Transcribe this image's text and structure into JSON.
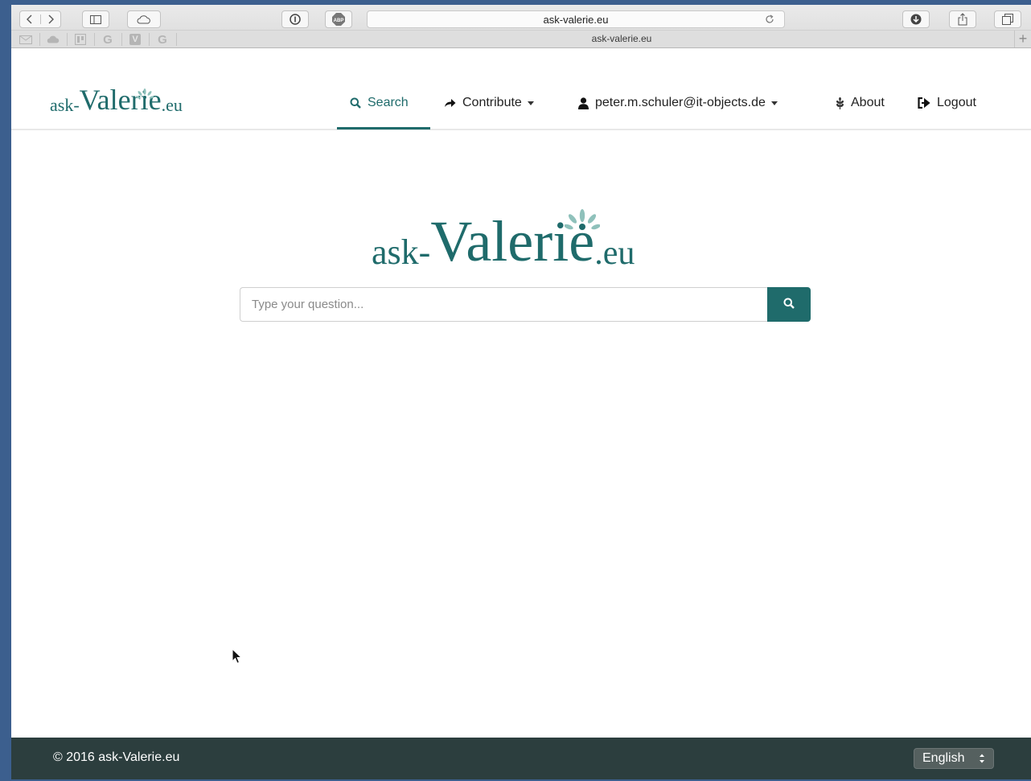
{
  "browser": {
    "address": "ask-valerie.eu",
    "tab_title": "ask-valerie.eu",
    "favorites": [
      "mail-icon",
      "cloud-icon",
      "trello-icon",
      "G",
      "V",
      "G"
    ],
    "new_tab": "+"
  },
  "nav": {
    "logo": {
      "prefix": "ask-",
      "main": "Valerie",
      "suffix": ".eu"
    },
    "search": "Search",
    "contribute": "Contribute",
    "user": "peter.m.schuler@it-objects.de",
    "about": "About",
    "logout": "Logout"
  },
  "hero": {
    "logo": {
      "prefix": "ask-",
      "main": "Valerie",
      "suffix": ".eu"
    }
  },
  "search": {
    "placeholder": "Type your question...",
    "value": ""
  },
  "footer": {
    "copyright": "© 2016 ask-Valerie.eu",
    "language": "English"
  },
  "colors": {
    "brand": "#1f6b6b",
    "footer_bg": "#2c3e3e",
    "desktop_bg": "#3c5f8e"
  }
}
